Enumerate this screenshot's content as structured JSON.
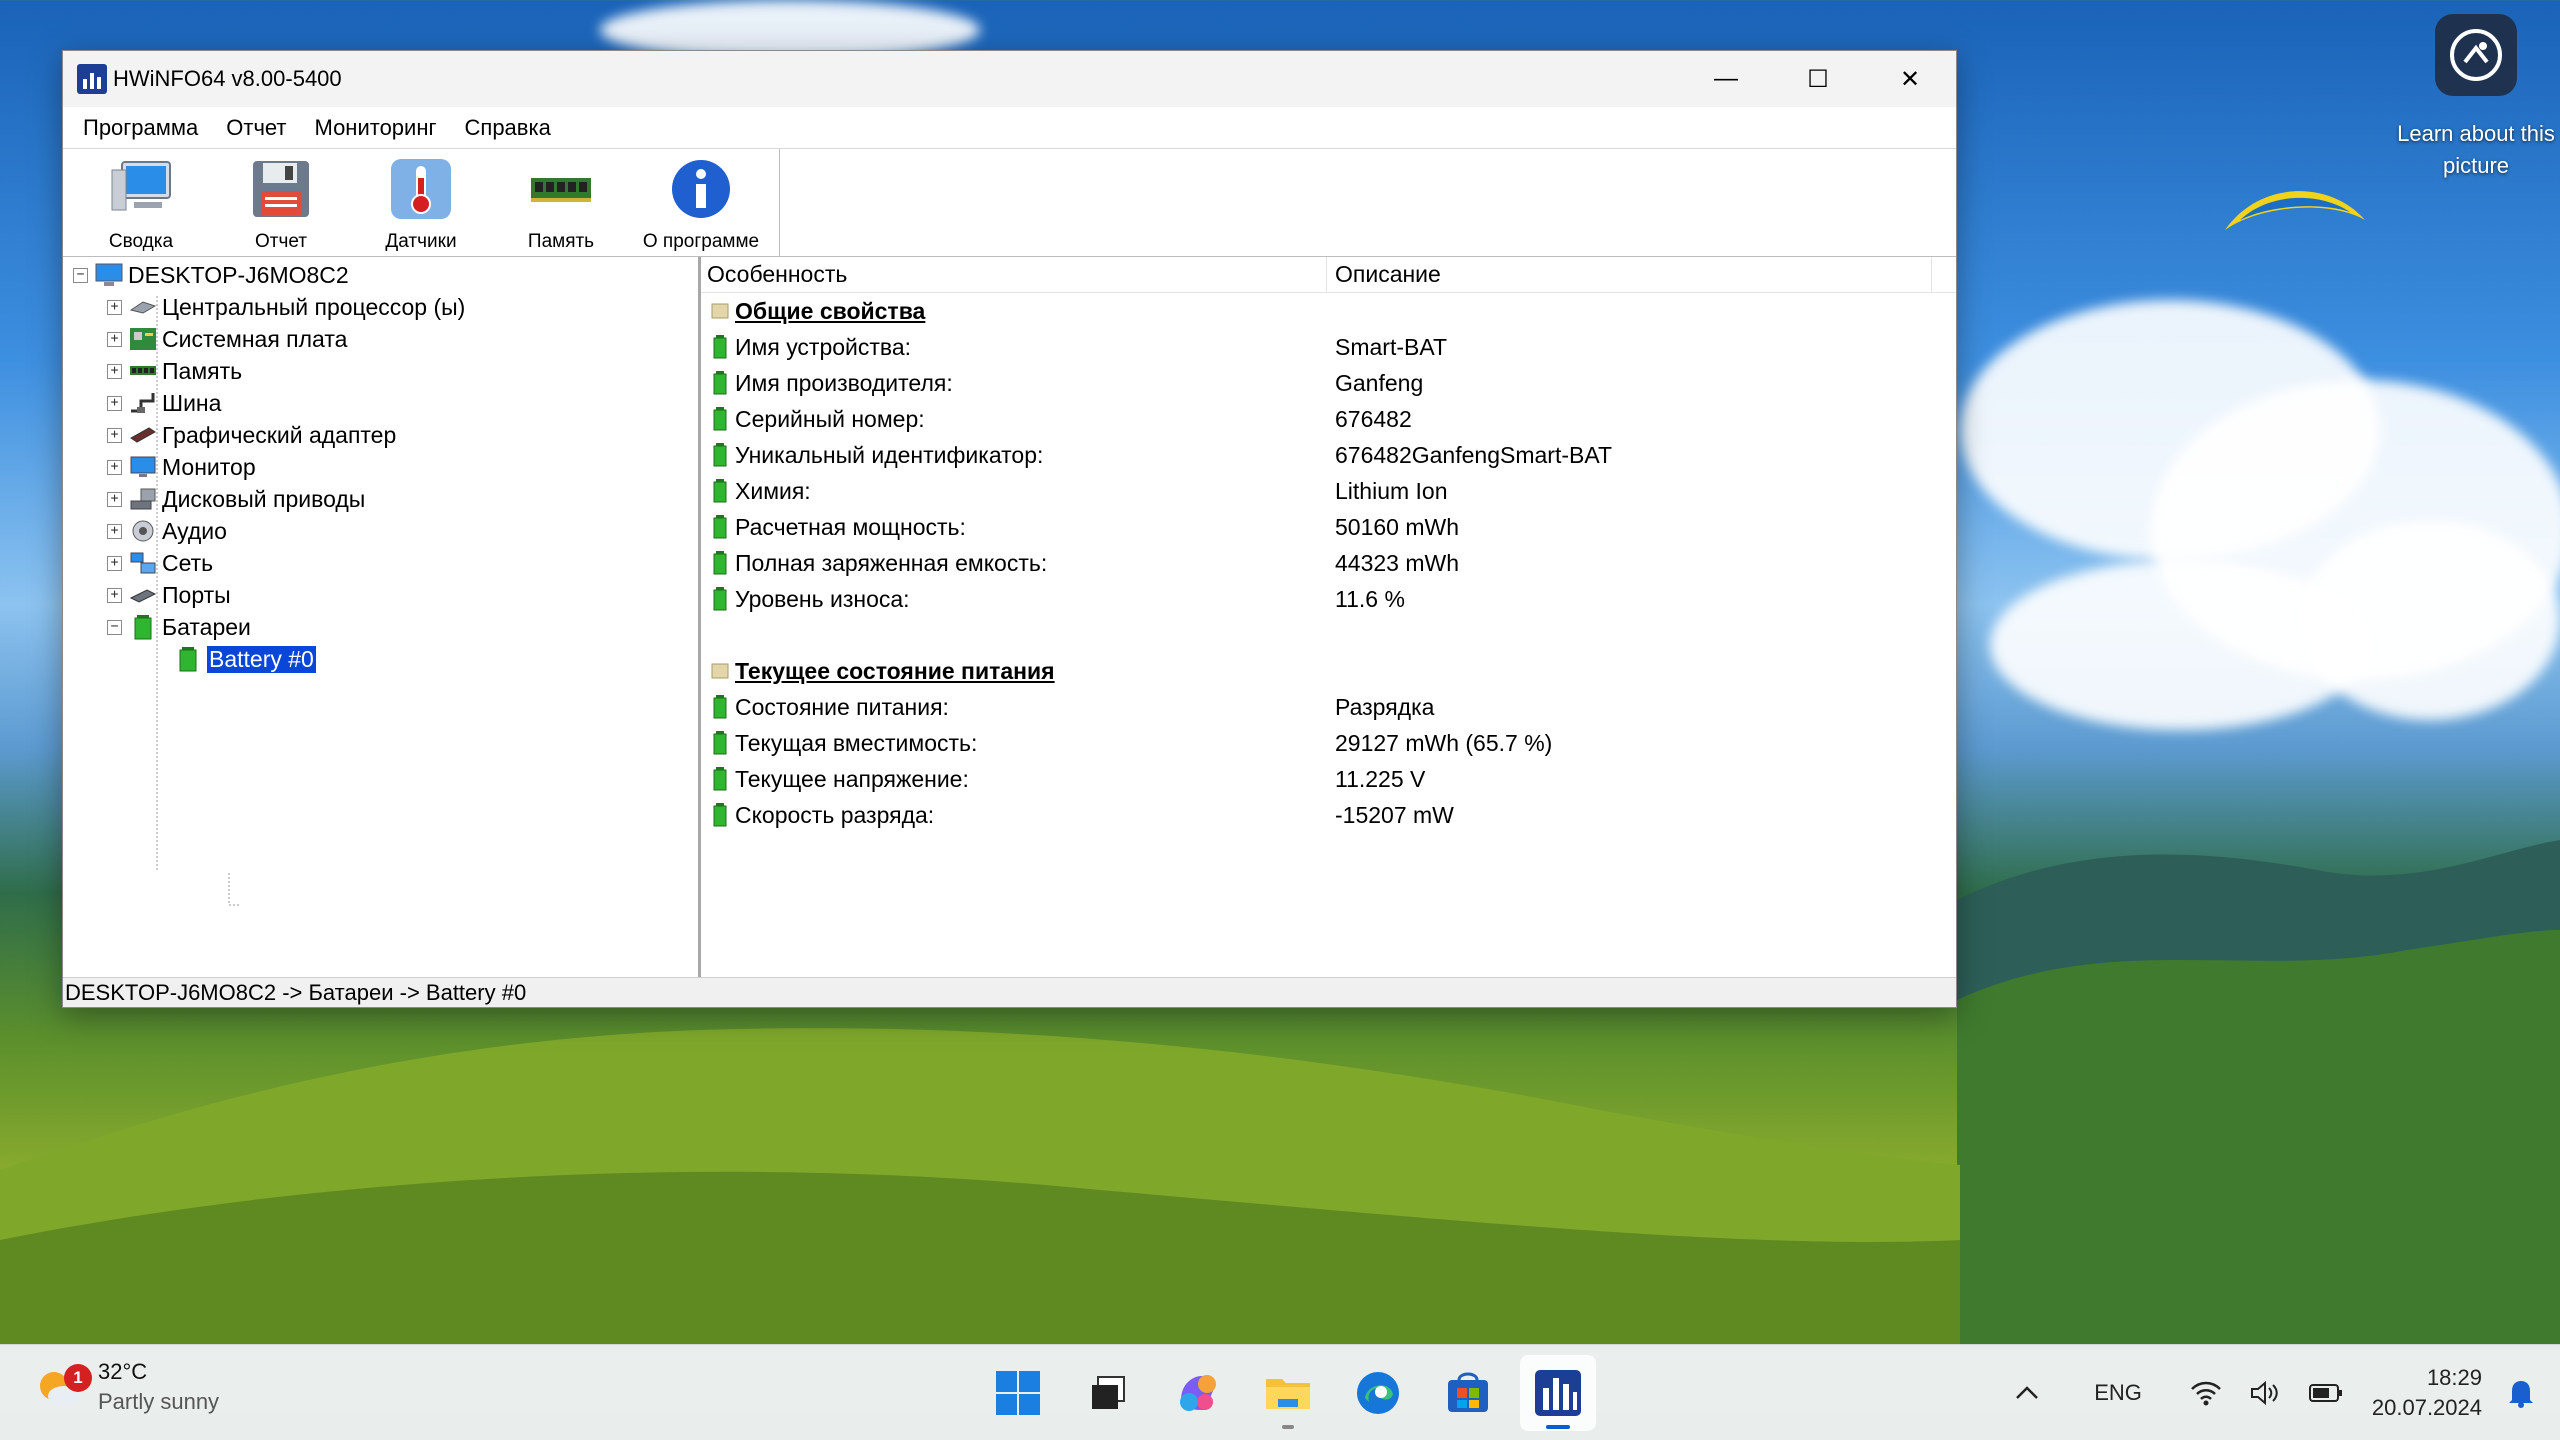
{
  "desktop": {
    "learn_label": "Learn about this picture"
  },
  "window": {
    "title": "HWiNFO64 v8.00-5400",
    "controls": {
      "minimize": "—",
      "maximize": "☐",
      "close": "✕"
    }
  },
  "menu": [
    "Программа",
    "Отчет",
    "Мониторинг",
    "Справка"
  ],
  "toolbar": [
    {
      "label": "Сводка",
      "icon": "monitor-icon"
    },
    {
      "label": "Отчет",
      "icon": "floppy-disk-icon"
    },
    {
      "label": "Датчики",
      "icon": "thermometer-icon"
    },
    {
      "label": "Память",
      "icon": "memory-module-icon"
    },
    {
      "label": "О программе",
      "icon": "info-icon"
    }
  ],
  "tree": {
    "root": "DESKTOP-J6MO8C2",
    "items": [
      {
        "label": "Центральный процессор (ы)",
        "icon": "cpu-icon",
        "expander": "+"
      },
      {
        "label": "Системная плата",
        "icon": "motherboard-icon",
        "expander": "+"
      },
      {
        "label": "Память",
        "icon": "memory-icon",
        "expander": "+"
      },
      {
        "label": "Шина",
        "icon": "bus-icon",
        "expander": "+"
      },
      {
        "label": "Графический адаптер",
        "icon": "gpu-icon",
        "expander": "+"
      },
      {
        "label": "Монитор",
        "icon": "monitor-icon",
        "expander": "+"
      },
      {
        "label": "Дисковый приводы",
        "icon": "drive-icon",
        "expander": "+"
      },
      {
        "label": "Аудио",
        "icon": "audio-icon",
        "expander": "+"
      },
      {
        "label": "Сеть",
        "icon": "network-icon",
        "expander": "+"
      },
      {
        "label": "Порты",
        "icon": "ports-icon",
        "expander": "+"
      },
      {
        "label": "Батареи",
        "icon": "battery-icon",
        "expander": "−"
      }
    ],
    "selected_child": "Battery #0"
  },
  "details": {
    "col_feature": "Особенность",
    "col_description": "Описание",
    "section1": "Общие свойства",
    "rows1": [
      {
        "k": "Имя устройства:",
        "v": "Smart-BAT"
      },
      {
        "k": "Имя производителя:",
        "v": "Ganfeng"
      },
      {
        "k": "Серийный номер:",
        "v": "676482"
      },
      {
        "k": "Уникальный идентификатор:",
        "v": "676482GanfengSmart-BAT"
      },
      {
        "k": "Химия:",
        "v": "Lithium Ion"
      },
      {
        "k": "Расчетная мощность:",
        "v": "50160 mWh"
      },
      {
        "k": "Полная заряженная емкость:",
        "v": "44323 mWh"
      },
      {
        "k": "Уровень износа:",
        "v": "11.6 %"
      }
    ],
    "section2": "Текущее состояние питания",
    "rows2": [
      {
        "k": "Состояние питания:",
        "v": "Разрядка"
      },
      {
        "k": "Текущая вместимость:",
        "v": "29127 mWh (65.7 %)"
      },
      {
        "k": "Текущее напряжение:",
        "v": "11.225 V"
      },
      {
        "k": "Скорость разряда:",
        "v": "-15207 mW"
      }
    ]
  },
  "statusbar": "DESKTOP-J6MO8C2 -> Батареи -> Battery #0",
  "taskbar": {
    "weather_temp": "32°C",
    "weather_cond": "Partly sunny",
    "weather_badge": "1",
    "lang": "ENG",
    "time": "18:29",
    "date": "20.07.2024"
  }
}
